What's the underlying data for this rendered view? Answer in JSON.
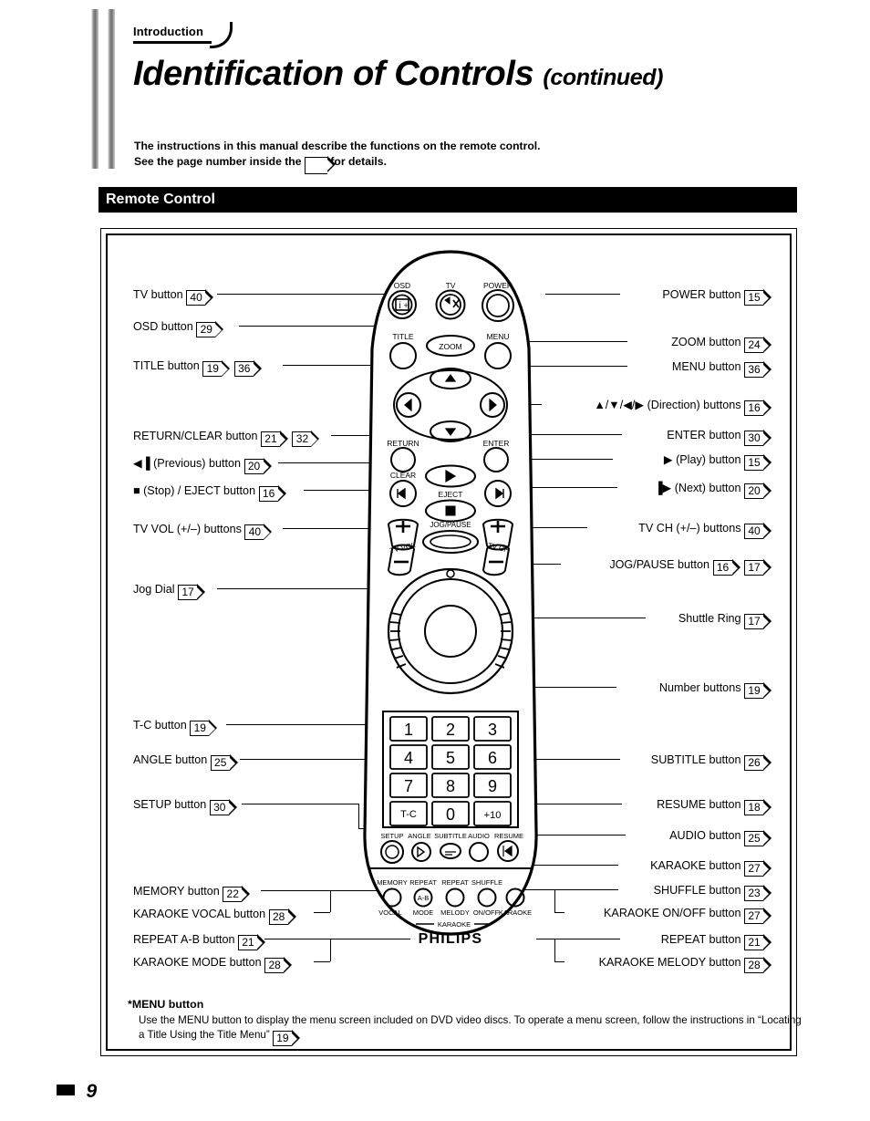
{
  "document": {
    "section_tab": "Introduction",
    "title": "Identification of Controls",
    "title_suffix": "(continued)",
    "intro_line1": "The instructions in this manual describe the functions on the remote control.",
    "intro_line2_before": "See the page number inside the",
    "intro_line2_after": "for details.",
    "section_heading": "Remote Control",
    "page_number": "9"
  },
  "footnote": {
    "heading": "*MENU button",
    "body_before": "Use the MENU button to display the menu screen included on DVD video discs. To operate a menu screen, follow the instructions in “Locating a Title Using the Title Menu”",
    "page_ref": "19",
    "body_after": "."
  },
  "left_labels": [
    {
      "name": "tv-button",
      "text": "TV  button",
      "refs": [
        "40"
      ]
    },
    {
      "name": "osd-button",
      "text": "OSD button",
      "refs": [
        "29"
      ]
    },
    {
      "name": "title-button",
      "text": "TITLE button",
      "refs": [
        "19",
        "36"
      ]
    },
    {
      "name": "return-clear-button",
      "text": "RETURN/CLEAR button",
      "refs": [
        "21",
        "32"
      ]
    },
    {
      "name": "previous-button",
      "text": "◀▐ (Previous) button",
      "refs": [
        "20"
      ]
    },
    {
      "name": "stop-eject-button",
      "text": "■ (Stop) / EJECT button",
      "refs": [
        "16"
      ]
    },
    {
      "name": "tv-vol-buttons",
      "text": "TV VOL (+/–) buttons",
      "refs": [
        "40"
      ]
    },
    {
      "name": "jog-dial",
      "text": "Jog Dial",
      "refs": [
        "17"
      ]
    },
    {
      "name": "tc-button",
      "text": "T-C button",
      "refs": [
        "19"
      ]
    },
    {
      "name": "angle-button",
      "text": "ANGLE button",
      "refs": [
        "25"
      ]
    },
    {
      "name": "setup-button",
      "text": "SETUP button",
      "refs": [
        "30"
      ]
    },
    {
      "name": "memory-button",
      "text": "MEMORY button",
      "refs": [
        "22"
      ]
    },
    {
      "name": "karaoke-vocal-button",
      "text": "KARAOKE VOCAL button",
      "refs": [
        "28"
      ]
    },
    {
      "name": "repeat-ab-button",
      "text": "REPEAT A-B button",
      "refs": [
        "21"
      ]
    },
    {
      "name": "karaoke-mode-button",
      "text": "KARAOKE MODE button",
      "refs": [
        "28"
      ]
    }
  ],
  "right_labels": [
    {
      "name": "power-button",
      "text": "POWER button",
      "refs": [
        "15"
      ]
    },
    {
      "name": "zoom-button",
      "text": "ZOOM button",
      "refs": [
        "24"
      ]
    },
    {
      "name": "menu-button",
      "text": "MENU button",
      "refs": [
        "36"
      ]
    },
    {
      "name": "direction-buttons",
      "text": "▲/▼/◀/▶ (Direction) buttons",
      "refs": [
        "16"
      ]
    },
    {
      "name": "enter-button",
      "text": "ENTER button",
      "refs": [
        "30"
      ]
    },
    {
      "name": "play-button",
      "text": "▶ (Play) button",
      "refs": [
        "15"
      ]
    },
    {
      "name": "next-button",
      "text": "▐▶ (Next) button",
      "refs": [
        "20"
      ]
    },
    {
      "name": "tv-ch-buttons",
      "text": "TV CH (+/–) buttons",
      "refs": [
        "40"
      ]
    },
    {
      "name": "jog-pause-button",
      "text": "JOG/PAUSE button",
      "refs": [
        "16",
        "17"
      ]
    },
    {
      "name": "shuttle-ring",
      "text": "Shuttle Ring",
      "refs": [
        "17"
      ]
    },
    {
      "name": "number-buttons",
      "text": "Number buttons",
      "refs": [
        "19"
      ]
    },
    {
      "name": "subtitle-button",
      "text": "SUBTITLE button",
      "refs": [
        "26"
      ]
    },
    {
      "name": "resume-button",
      "text": "RESUME button",
      "refs": [
        "18"
      ]
    },
    {
      "name": "audio-button",
      "text": "AUDIO button",
      "refs": [
        "25"
      ]
    },
    {
      "name": "karaoke-button",
      "text": "KARAOKE button",
      "refs": [
        "27"
      ]
    },
    {
      "name": "shuffle-button",
      "text": "SHUFFLE button",
      "refs": [
        "23"
      ]
    },
    {
      "name": "karaoke-onoff-button",
      "text": "KARAOKE ON/OFF button",
      "refs": [
        "27"
      ]
    },
    {
      "name": "repeat-button",
      "text": "REPEAT button",
      "refs": [
        "21"
      ]
    },
    {
      "name": "karaoke-melody-button",
      "text": "KARAOKE MELODY button",
      "refs": [
        "28"
      ]
    }
  ],
  "remote": {
    "brand": "PHILIPS",
    "top_row_labels": [
      "OSD",
      "TV",
      "POWER"
    ],
    "second_row_labels": [
      "TITLE",
      "ZOOM",
      "MENU"
    ],
    "return_label": "RETURN",
    "enter_label": "ENTER",
    "clear_label": "CLEAR",
    "eject_label": "EJECT",
    "tv_vol_label": "TV VOL",
    "tv_ch_label": "TV CH",
    "jog_pause_label": "JOG/PAUSE",
    "keypad": [
      "1",
      "2",
      "3",
      "4",
      "5",
      "6",
      "7",
      "8",
      "9",
      "T-C",
      "0",
      "+10"
    ],
    "function_row_labels": [
      "SETUP",
      "ANGLE",
      "SUBTITLE",
      "AUDIO",
      "RESUME"
    ],
    "karaoke_top_labels": [
      "MEMORY",
      "REPEAT",
      "REPEAT",
      "SHUFFLE"
    ],
    "karaoke_bottom_labels": [
      "VOCAL",
      "MODE",
      "MELODY",
      "ON/OFF",
      "KARAOKE"
    ],
    "karaoke_group_label": "KARAOKE",
    "ab_label": "A-B"
  }
}
